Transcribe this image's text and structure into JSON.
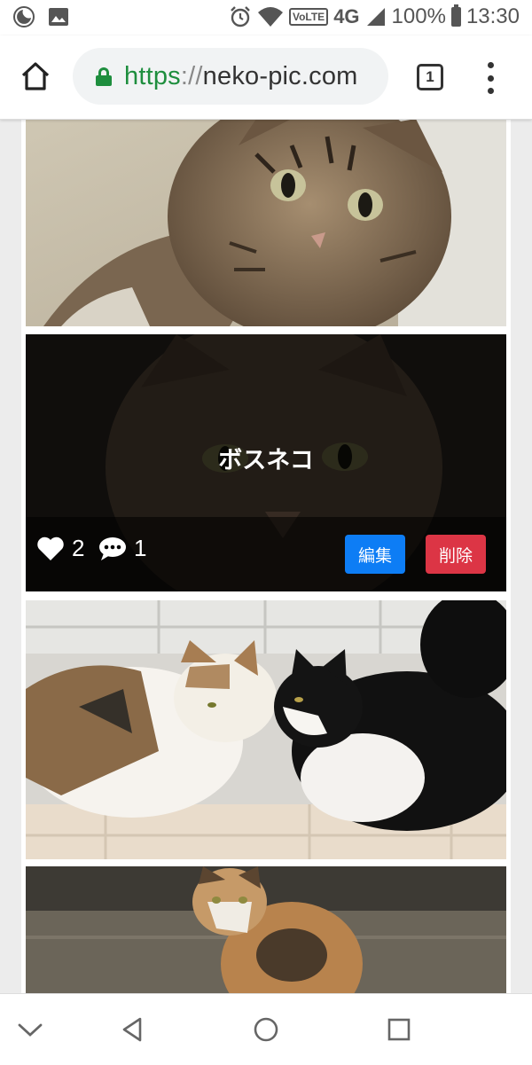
{
  "status_bar": {
    "left_icons": [
      "moon-icon",
      "image-icon"
    ],
    "right_icons": [
      "alarm-icon",
      "wifi-icon",
      "volte-badge",
      "signal-icon",
      "battery-icon"
    ],
    "volte": "VoLTE",
    "network": "4G",
    "battery": "100%",
    "time": "13:30"
  },
  "browser": {
    "url_scheme": "https",
    "url_sep": "://",
    "url_host": "neko-pic.com",
    "tab_count": "1",
    "icons": [
      "home-icon",
      "lock-icon",
      "tabs-icon",
      "more-vert-icon"
    ]
  },
  "posts": [
    {
      "id": "post-1",
      "image": "tabby-kitten-photo"
    },
    {
      "id": "post-2",
      "image": "boss-cat-photo",
      "title": "ボスネコ",
      "likes": "2",
      "comments": "1",
      "edit_label": "編集",
      "delete_label": "削除",
      "colors": {
        "edit": "#0d7df5",
        "delete": "#dc3545"
      }
    },
    {
      "id": "post-3",
      "image": "calico-and-black-white-cats-photo"
    },
    {
      "id": "post-4",
      "image": "calico-cat-walking-photo"
    }
  ],
  "nav_bar": {
    "icons": [
      "chevron-down-icon",
      "back-icon",
      "home-circle-icon",
      "recents-icon"
    ]
  }
}
